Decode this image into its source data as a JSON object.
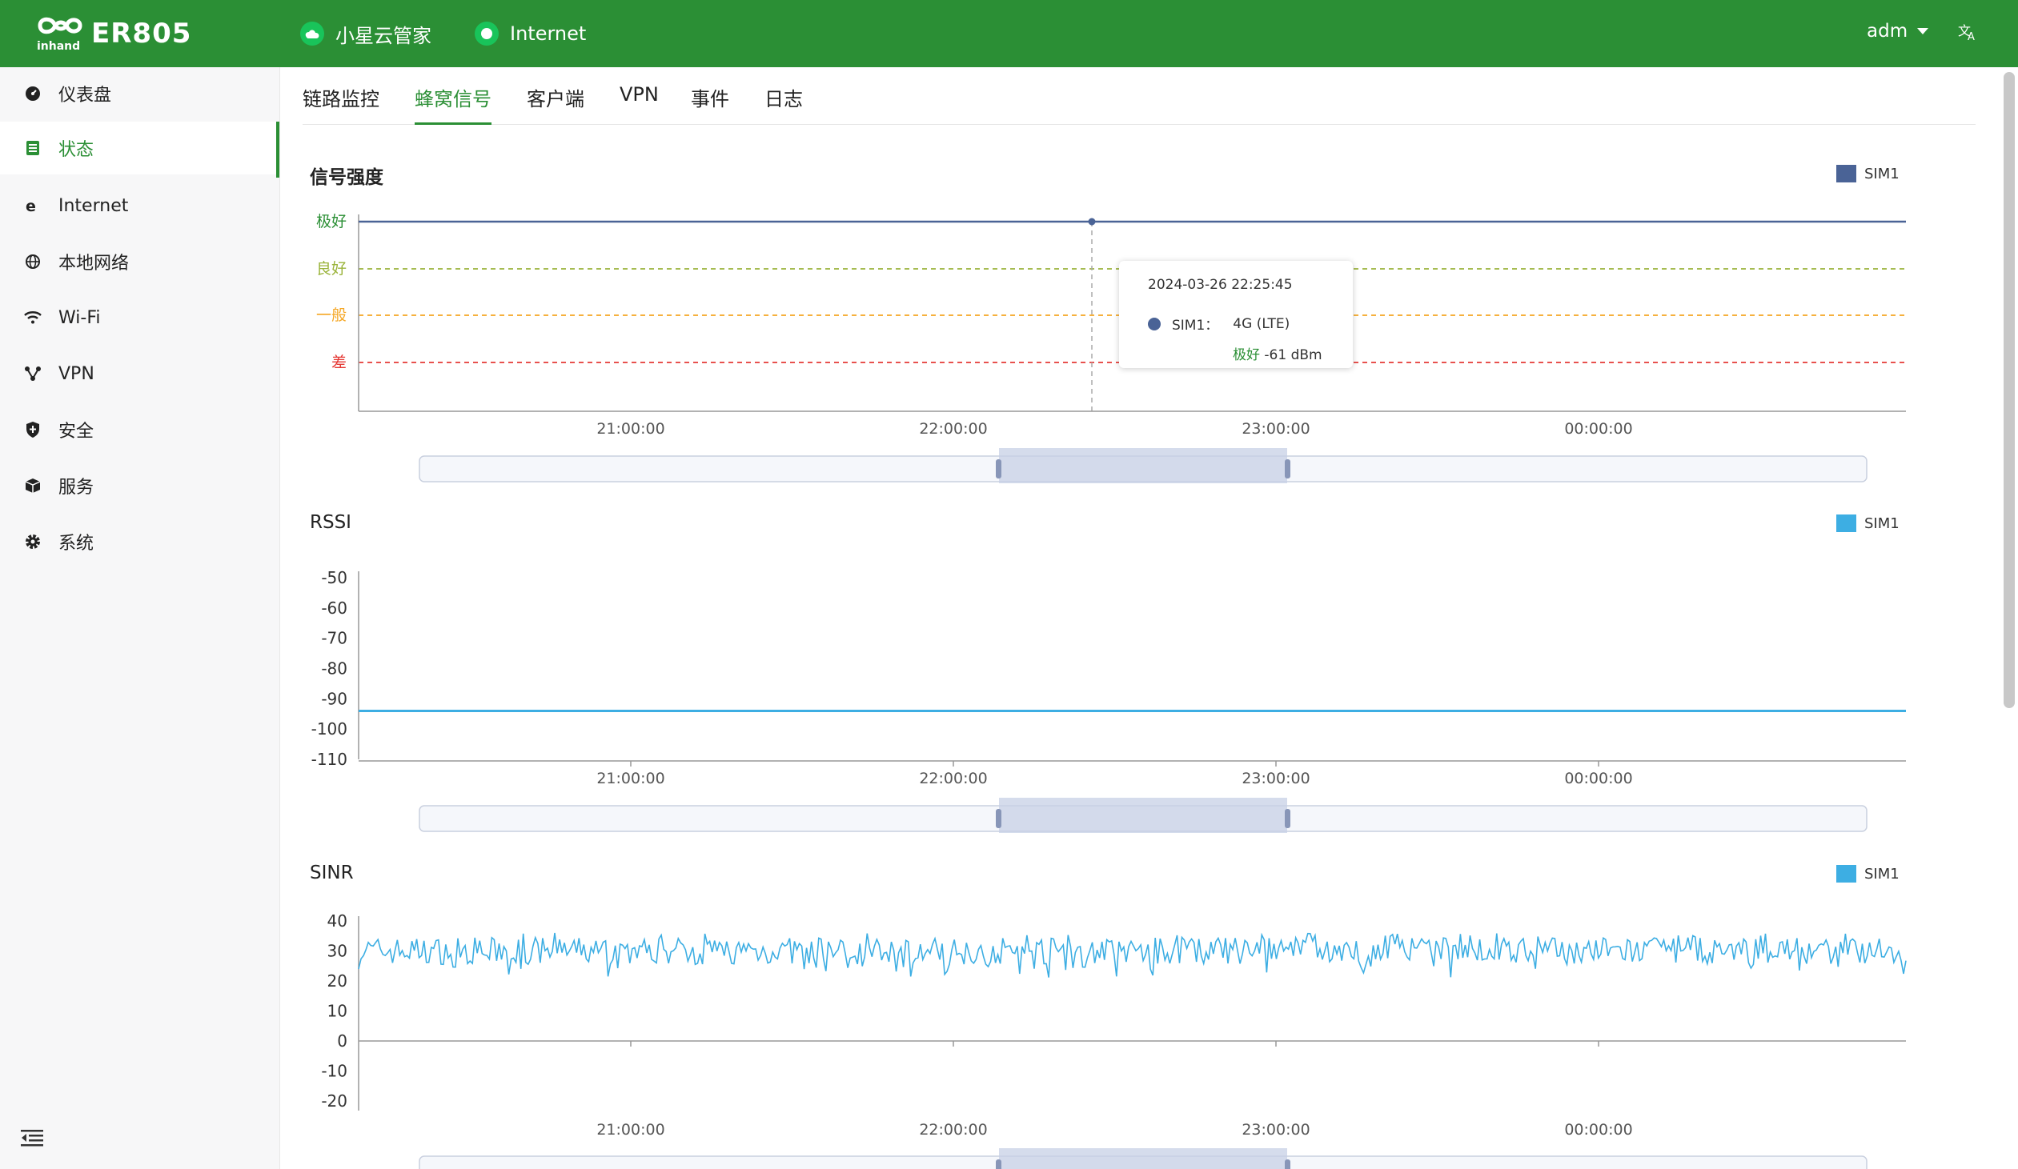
{
  "header": {
    "product": "ER805",
    "brand_mark": "inhand",
    "cloud_label": "小星云管家",
    "internet_label": "Internet",
    "user": "adm",
    "lang_icon": "translate-icon",
    "bar_color": "#2b8f35"
  },
  "sidebar": {
    "items": [
      {
        "label": "仪表盘",
        "icon": "dashboard-icon"
      },
      {
        "label": "状态",
        "icon": "status-icon",
        "active": true
      },
      {
        "label": "Internet",
        "icon": "internet-icon"
      },
      {
        "label": "本地网络",
        "icon": "globe-icon"
      },
      {
        "label": "Wi-Fi",
        "icon": "wifi-icon"
      },
      {
        "label": "VPN",
        "icon": "vpn-icon"
      },
      {
        "label": "安全",
        "icon": "shield-icon"
      },
      {
        "label": "服务",
        "icon": "cube-icon"
      },
      {
        "label": "系统",
        "icon": "gear-icon"
      }
    ]
  },
  "tabs": [
    "链路监控",
    "蜂窝信号",
    "客户端",
    "VPN",
    "事件",
    "日志"
  ],
  "active_tab": "蜂窝信号",
  "tooltip": {
    "time": "2024-03-26 22:25:45",
    "series": "SIM1：",
    "network": "4G (LTE)",
    "quality": "极好",
    "value": "-61 dBm"
  },
  "chart_data": [
    {
      "type": "line",
      "title": "信号强度",
      "legend": "SIM1",
      "legend_color": "#4a6396",
      "legend_position": "top-right",
      "y_categories": [
        "差",
        "一般",
        "良好",
        "极好"
      ],
      "y_category_colors": [
        "#e53935",
        "#f5a623",
        "#9ab33a",
        "#2b8f35"
      ],
      "x_ticks": [
        "21:00:00",
        "22:00:00",
        "23:00:00",
        "00:00:00"
      ],
      "series": [
        {
          "name": "SIM1",
          "level": "极好",
          "constant": true
        }
      ]
    },
    {
      "type": "line",
      "title": "RSSI",
      "legend": "SIM1",
      "legend_color": "#3daee3",
      "legend_position": "top-right",
      "y_ticks": [
        -50,
        -60,
        -70,
        -80,
        -90,
        -100,
        -110
      ],
      "ylim": [
        -110,
        -50
      ],
      "x_ticks": [
        "21:00:00",
        "22:00:00",
        "23:00:00",
        "00:00:00"
      ],
      "series": [
        {
          "name": "SIM1",
          "value": -94,
          "constant": true
        }
      ]
    },
    {
      "type": "line",
      "title": "SINR",
      "legend": "SIM1",
      "legend_color": "#3daee3",
      "legend_position": "top-right",
      "y_ticks": [
        40,
        30,
        20,
        10,
        0,
        -10,
        -20
      ],
      "ylim": [
        -20,
        40
      ],
      "x_ticks": [
        "21:00:00",
        "22:00:00",
        "23:00:00",
        "00:00:00"
      ],
      "series": [
        {
          "name": "SIM1",
          "mean": 30,
          "min": 21,
          "max": 36
        }
      ]
    }
  ]
}
